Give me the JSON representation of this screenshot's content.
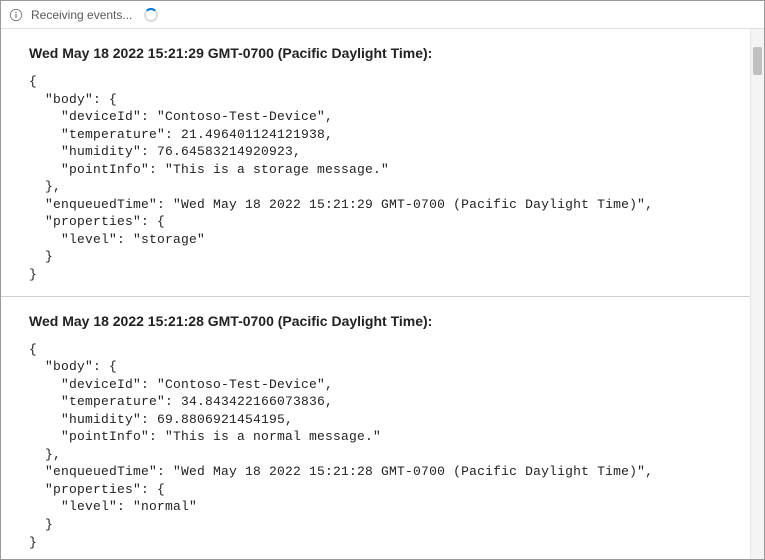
{
  "status": {
    "text": "Receiving events..."
  },
  "events": [
    {
      "header": "Wed May 18 2022 15:21:29 GMT-0700 (Pacific Daylight Time):",
      "json": "{\n  \"body\": {\n    \"deviceId\": \"Contoso-Test-Device\",\n    \"temperature\": 21.496401124121938,\n    \"humidity\": 76.64583214920923,\n    \"pointInfo\": \"This is a storage message.\"\n  },\n  \"enqueuedTime\": \"Wed May 18 2022 15:21:29 GMT-0700 (Pacific Daylight Time)\",\n  \"properties\": {\n    \"level\": \"storage\"\n  }\n}"
    },
    {
      "header": "Wed May 18 2022 15:21:28 GMT-0700 (Pacific Daylight Time):",
      "json": "{\n  \"body\": {\n    \"deviceId\": \"Contoso-Test-Device\",\n    \"temperature\": 34.843422166073836,\n    \"humidity\": 69.8806921454195,\n    \"pointInfo\": \"This is a normal message.\"\n  },\n  \"enqueuedTime\": \"Wed May 18 2022 15:21:28 GMT-0700 (Pacific Daylight Time)\",\n  \"properties\": {\n    \"level\": \"normal\"\n  }\n}"
    }
  ]
}
